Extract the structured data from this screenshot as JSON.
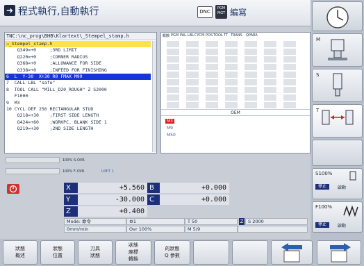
{
  "header": {
    "mode_icon": "program-run-icon",
    "mode_title": "程式執行,自動執行",
    "dnc_label": "DNC",
    "pgm_label": "PGM MGT",
    "edit_title": "編寫"
  },
  "program": {
    "path": "TNC:\\nc_prog\\BHB\\Klartext\\_Stempel_stamp.h",
    "lines": [
      {
        "text": "→_Stempel_stamp.h",
        "highlight": "yellow"
      },
      {
        "text": "    Q349=+0     ;3RD LIMIT",
        "highlight": "none"
      },
      {
        "text": "    Q220=+0     ;CORNER RADIUS",
        "highlight": "none"
      },
      {
        "text": "    Q368=+0     ;ALLOWANCE FOR SIDE",
        "highlight": "none"
      },
      {
        "text": "    Q338=+0     ;INFEED FOR FINISHING",
        "highlight": "none"
      },
      {
        "text": "6  L  Y-30  X+30 R0 FMAX M99",
        "highlight": "blue"
      },
      {
        "text": "7  CALL LBL \"safe\"",
        "highlight": "none"
      },
      {
        "text": "8  TOOL CALL \"MILL_D20_ROUGH\" Z S2000",
        "highlight": "none"
      },
      {
        "text": "   F1000",
        "highlight": "none"
      },
      {
        "text": "9  M3",
        "highlight": "none"
      },
      {
        "text": "10 CYCL DEF 256 RECTANGULAR STUD",
        "highlight": "none"
      },
      {
        "text": "    Q218=+30    ;FIRST SIDE LENGTH",
        "highlight": "none"
      },
      {
        "text": "    Q424=+60    ;WORKPC. BLANK SIDE 1",
        "highlight": "none"
      },
      {
        "text": "    Q219=+30    ;2ND SIDE LENGTH",
        "highlight": "none"
      }
    ]
  },
  "status": {
    "tabs": [
      "概觀",
      "PGM",
      "PAL",
      "LBL",
      "CYC",
      "M",
      "POS",
      "TOOL",
      "TT",
      "TRANS",
      "QPARA"
    ],
    "oem_label": "OEM",
    "m_codes": [
      "M3",
      "M9",
      "M50"
    ]
  },
  "overrides": {
    "s_ovr": "100% S-OVR",
    "f_ovr": "100% F-OVR",
    "limit": "LIMIT 1"
  },
  "positions": {
    "axes": [
      {
        "name": "X",
        "value": "+5.560"
      },
      {
        "name": "Y",
        "value": "-30.000"
      },
      {
        "name": "Z",
        "value": "+0.400"
      }
    ],
    "axes2": [
      {
        "name": "B",
        "value": "+0.000"
      },
      {
        "name": "C",
        "value": "+0.000"
      }
    ],
    "mode": "Mode: 命令",
    "tool_t": "T 50",
    "spindle_axis": "Z",
    "spindle_s": "S 2000",
    "feed": "0mm/min",
    "ovr": "Ovr 100%",
    "m_func": "M 5/9"
  },
  "right_softkeys": [
    {
      "label": "M"
    },
    {
      "label": "S"
    },
    {
      "label": "T"
    },
    {
      "label": ""
    },
    {
      "label": "S100%",
      "sub1": "停止",
      "sub2": "啟動"
    },
    {
      "label": "F100%",
      "sub1": "停止",
      "sub2": "啟動"
    }
  ],
  "bottom_softkeys": [
    {
      "line1": "狀態",
      "line2": "概述"
    },
    {
      "line1": "狀態",
      "line2": "位置"
    },
    {
      "line1": "刀具",
      "line2": "狀態"
    },
    {
      "line1": "狀態",
      "line2": "座標",
      "line3": "轉換"
    },
    {
      "line1": "的狀態",
      "line2": "Q 參數"
    },
    {
      "line1": "",
      "line2": ""
    },
    {
      "line1": "",
      "line2": ""
    },
    {
      "line1": "",
      "line2": ""
    }
  ]
}
